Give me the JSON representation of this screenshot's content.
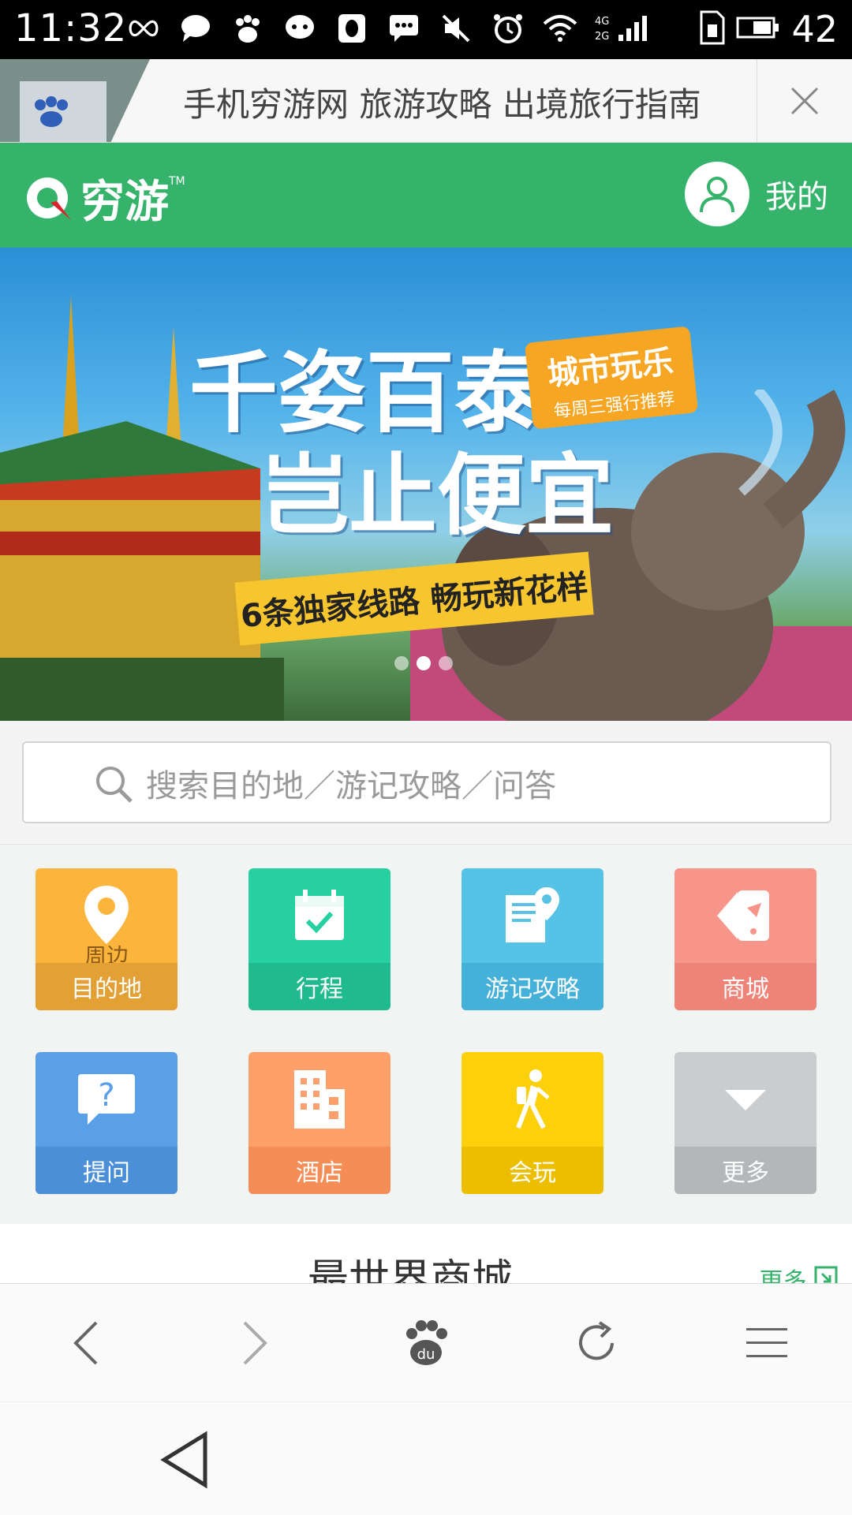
{
  "status_bar": {
    "time": "11:32",
    "battery_level": "42",
    "network_labels": [
      "4G",
      "2G"
    ]
  },
  "browser": {
    "page_title": "手机穷游网 旅游攻略 出境旅行指南"
  },
  "header": {
    "logo_text": "穷游",
    "logo_tm": "TM",
    "user_label": "我的"
  },
  "banner": {
    "title_line1": "千姿百泰",
    "title_line2": "岂止便宜",
    "badge_main": "城市玩乐",
    "badge_sub": "每周三强行推荐",
    "strip_text": "6条独家线路 畅玩新花样",
    "slide_count": 3,
    "active_slide": 1
  },
  "search": {
    "placeholder": "搜索目的地／游记攻略／问答"
  },
  "grid": {
    "items": [
      {
        "label": "目的地",
        "sublabel": "周边",
        "color": "#fbb53c",
        "bottom": "#e3a035",
        "icon": "location-pin-icon"
      },
      {
        "label": "行程",
        "color": "#26d0a0",
        "bottom": "#1fbb8e",
        "icon": "calendar-check-icon"
      },
      {
        "label": "游记攻略",
        "color": "#56c2e6",
        "bottom": "#45b0d8",
        "icon": "travel-notes-icon"
      },
      {
        "label": "商城",
        "color": "#f8958a",
        "bottom": "#ee8378",
        "icon": "ticket-tag-icon"
      },
      {
        "label": "提问",
        "color": "#5aa0e8",
        "bottom": "#4a8fd8",
        "icon": "question-bubble-icon"
      },
      {
        "label": "酒店",
        "color": "#ffa06b",
        "bottom": "#f58d57",
        "icon": "hotel-building-icon"
      },
      {
        "label": "会玩",
        "color": "#fcd00b",
        "bottom": "#ecbe00",
        "icon": "hiker-icon"
      },
      {
        "label": "更多",
        "color": "#c9cdd0",
        "bottom": "#b3b7ba",
        "icon": "chevron-down-icon"
      }
    ]
  },
  "section": {
    "title": "最世界商城",
    "more": "更多"
  }
}
